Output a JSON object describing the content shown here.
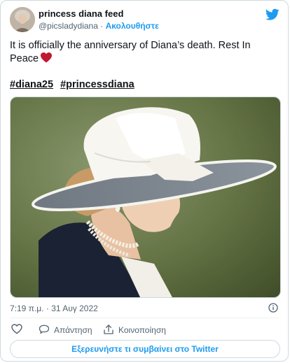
{
  "author": {
    "display_name": "princess diana feed",
    "handle": "@picsladydiana",
    "separator": "·",
    "follow_label": "Ακολουθήστε"
  },
  "tweet": {
    "text": "It is officially the anniversary of Diana’s death. Rest In Peace",
    "hashtags": [
      "#diana25",
      "#princessdiana"
    ],
    "timestamp": "7:19 π.μ. · 31 Αυγ 2022"
  },
  "actions": {
    "like_label": "",
    "reply_label": "Απάντηση",
    "share_label": "Κοινοποίηση"
  },
  "explore_label": "Εξερευνήστε τι συμβαίνει στο Twitter",
  "icons": {
    "brand": "twitter-bird-icon",
    "heart_emoji": "red-heart-icon",
    "info": "info-icon",
    "like": "heart-outline-icon",
    "reply": "speech-bubble-icon",
    "share": "share-upload-icon"
  },
  "colors": {
    "accent": "#1d9bf0",
    "heart": "#be1931",
    "text": "#0f1419",
    "muted": "#536471",
    "border": "#cfd9de"
  }
}
